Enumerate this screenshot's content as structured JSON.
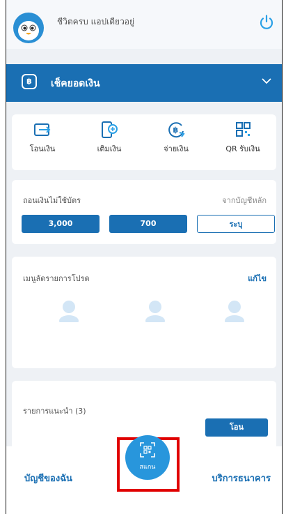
{
  "header": {
    "greeting": "ชีวิตครบ แอปเดียวอยู่"
  },
  "balance": {
    "icon_text": "฿",
    "label": "เช็คยอดเงิน"
  },
  "actions": [
    {
      "label": "โอนเงิน",
      "icon": "transfer-icon"
    },
    {
      "label": "เติมเงิน",
      "icon": "topup-icon"
    },
    {
      "label": "จ่ายเงิน",
      "icon": "pay-icon"
    },
    {
      "label": "QR รับเงิน",
      "icon": "qr-receive-icon"
    }
  ],
  "withdraw": {
    "title": "ถอนเงินไม่ใช้บัตร",
    "source": "จากบัญชีหลัก",
    "amounts": [
      "3,000",
      "700",
      "ระบุ"
    ]
  },
  "favorites": {
    "title": "เมนูลัดรายการโปรด",
    "edit": "แก้ไข"
  },
  "recommend": {
    "title": "รายการแนะนำ (3)",
    "button": "โอน"
  },
  "bottom_nav": {
    "left": "บัญชีของฉัน",
    "scan": "สแกน",
    "right": "บริการธนาคาร"
  },
  "colors": {
    "primary": "#1a6fb3",
    "scan": "#2896dc",
    "highlight": "#e00000"
  }
}
